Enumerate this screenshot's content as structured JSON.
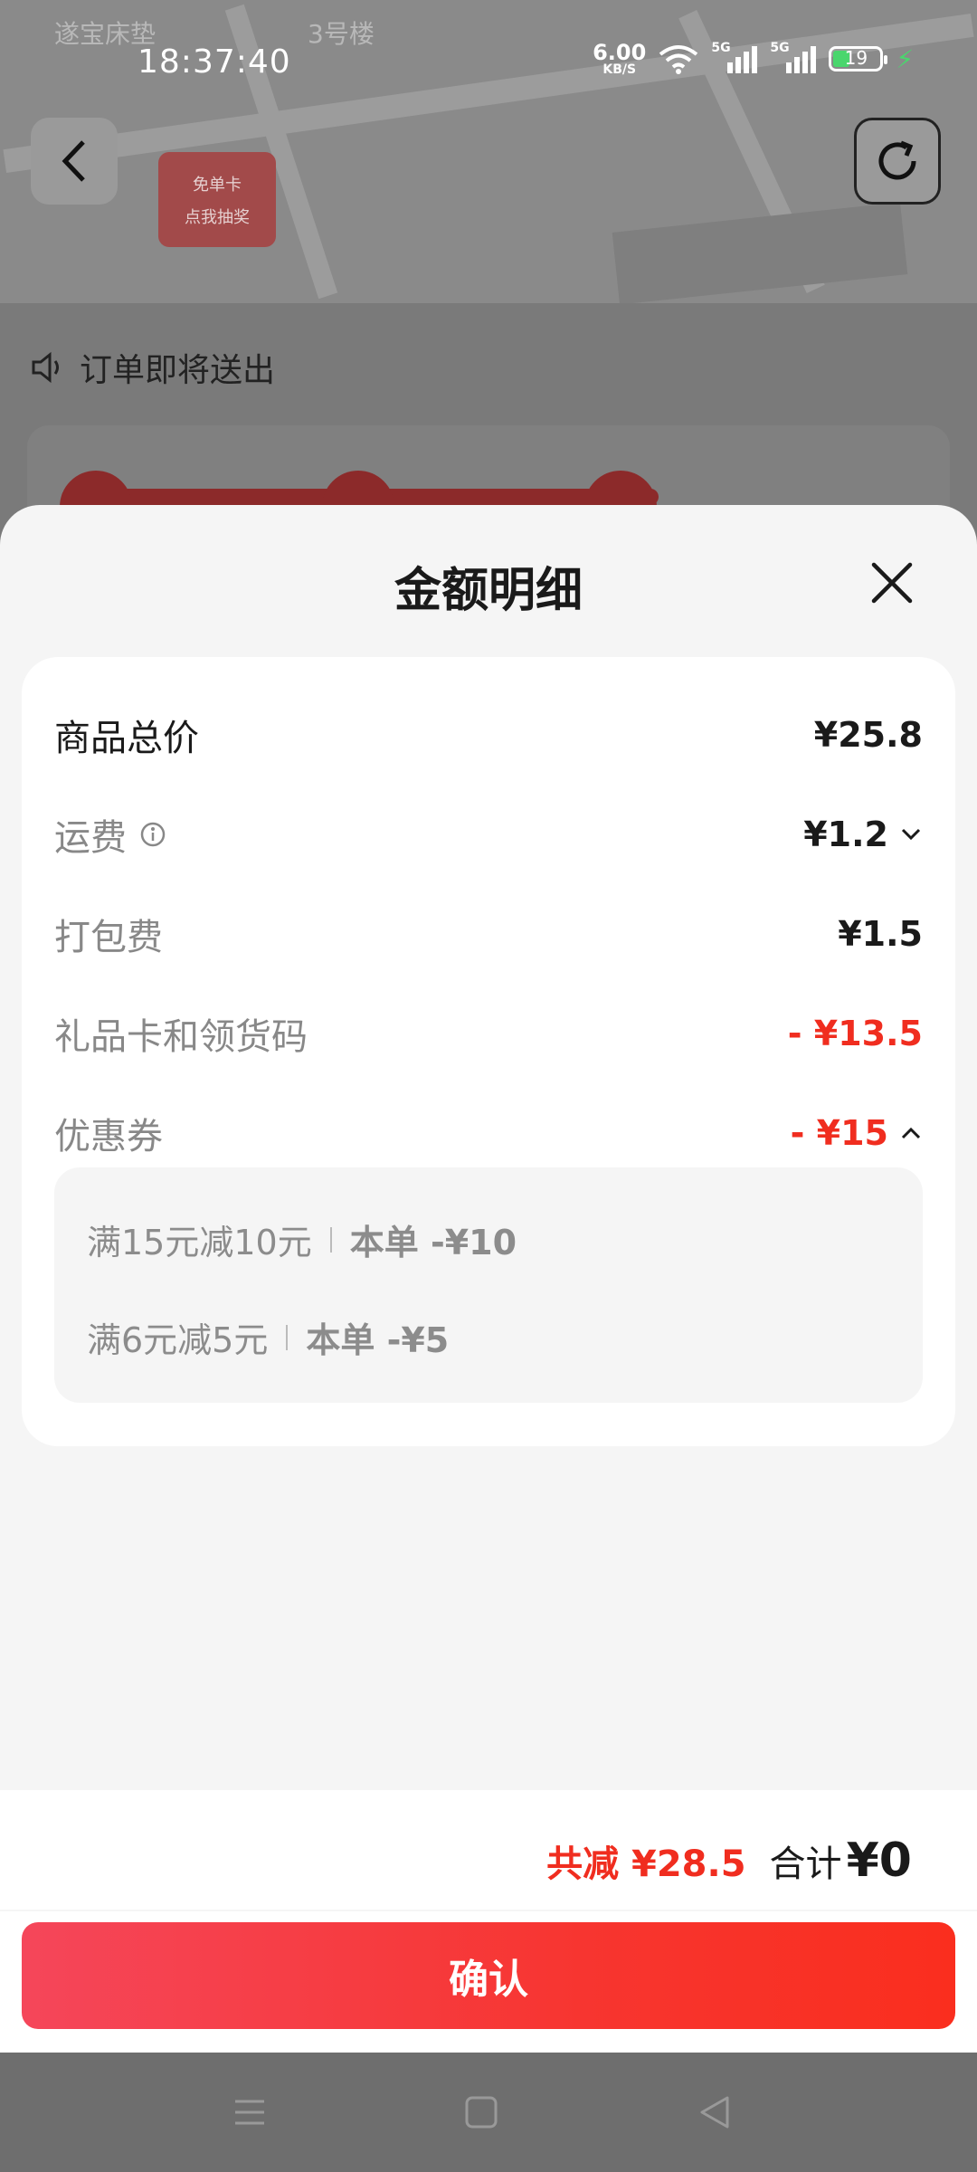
{
  "status_bar": {
    "time": "18:37:40",
    "net_speed_value": "6.00",
    "net_speed_unit": "KB/S",
    "signal_1_label": "5G",
    "signal_2_label": "5G",
    "battery_level": "19"
  },
  "background_page": {
    "map_top_label": "遂宝床垫",
    "map_top_label_2": "3号楼",
    "lottery_card_line1": "免单卡",
    "lottery_card_line2": "点我抽奖",
    "notice_text": "订单即将送出"
  },
  "sheet": {
    "title": "金额明细",
    "rows": [
      {
        "label": "商品总价",
        "amount": "¥25.8"
      },
      {
        "label": "运费",
        "amount": "¥1.2"
      },
      {
        "label": "打包费",
        "amount": "¥1.5"
      },
      {
        "label": "礼品卡和领货码",
        "amount": "- ¥13.5"
      },
      {
        "label": "优惠券",
        "amount": "- ¥15"
      }
    ],
    "coupons": [
      {
        "rule": "满15元减10元",
        "deduct": "本单 -¥10"
      },
      {
        "rule": "满6元减5元",
        "deduct": "本单 -¥5"
      }
    ]
  },
  "footer": {
    "saved_text": "共减 ¥28.5",
    "total_label": "合计",
    "total_amount": "¥0",
    "confirm_label": "确认"
  },
  "colors": {
    "accent_red": "#f02d1f",
    "battery_green": "#4ad66d"
  }
}
